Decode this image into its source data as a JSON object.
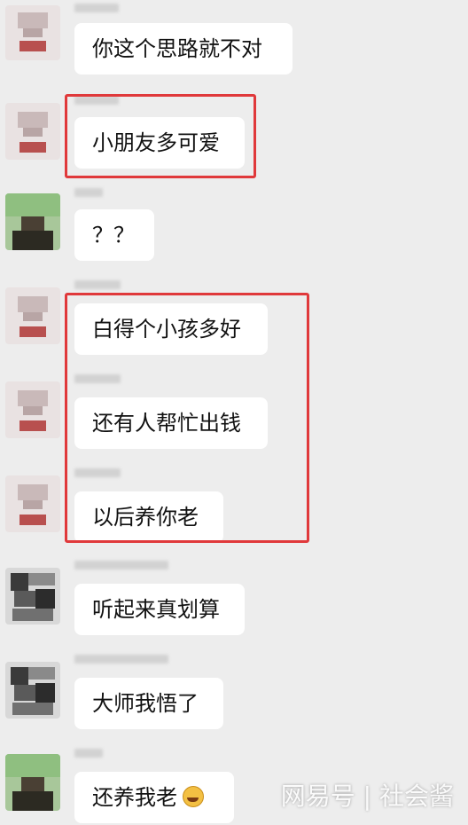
{
  "messages": [
    {
      "text": "你这个思路就不对",
      "avatar": "avatar-a"
    },
    {
      "text": "小朋友多可爱",
      "avatar": "avatar-a"
    },
    {
      "text": "？？",
      "avatar": "avatar-b"
    },
    {
      "text": "白得个小孩多好",
      "avatar": "avatar-a"
    },
    {
      "text": "还有人帮忙出钱",
      "avatar": "avatar-a"
    },
    {
      "text": "以后养你老",
      "avatar": "avatar-a"
    },
    {
      "text": "听起来真划算",
      "avatar": "avatar-c"
    },
    {
      "text": "大师我悟了",
      "avatar": "avatar-c"
    },
    {
      "text": "还养我老",
      "avatar": "avatar-b",
      "emoji": "laughing-tears-emoji"
    }
  ],
  "watermark": "网易号 | 社会酱",
  "colors": {
    "background": "#ededed",
    "bubble": "#ffffff",
    "highlight": "#e0393b"
  }
}
